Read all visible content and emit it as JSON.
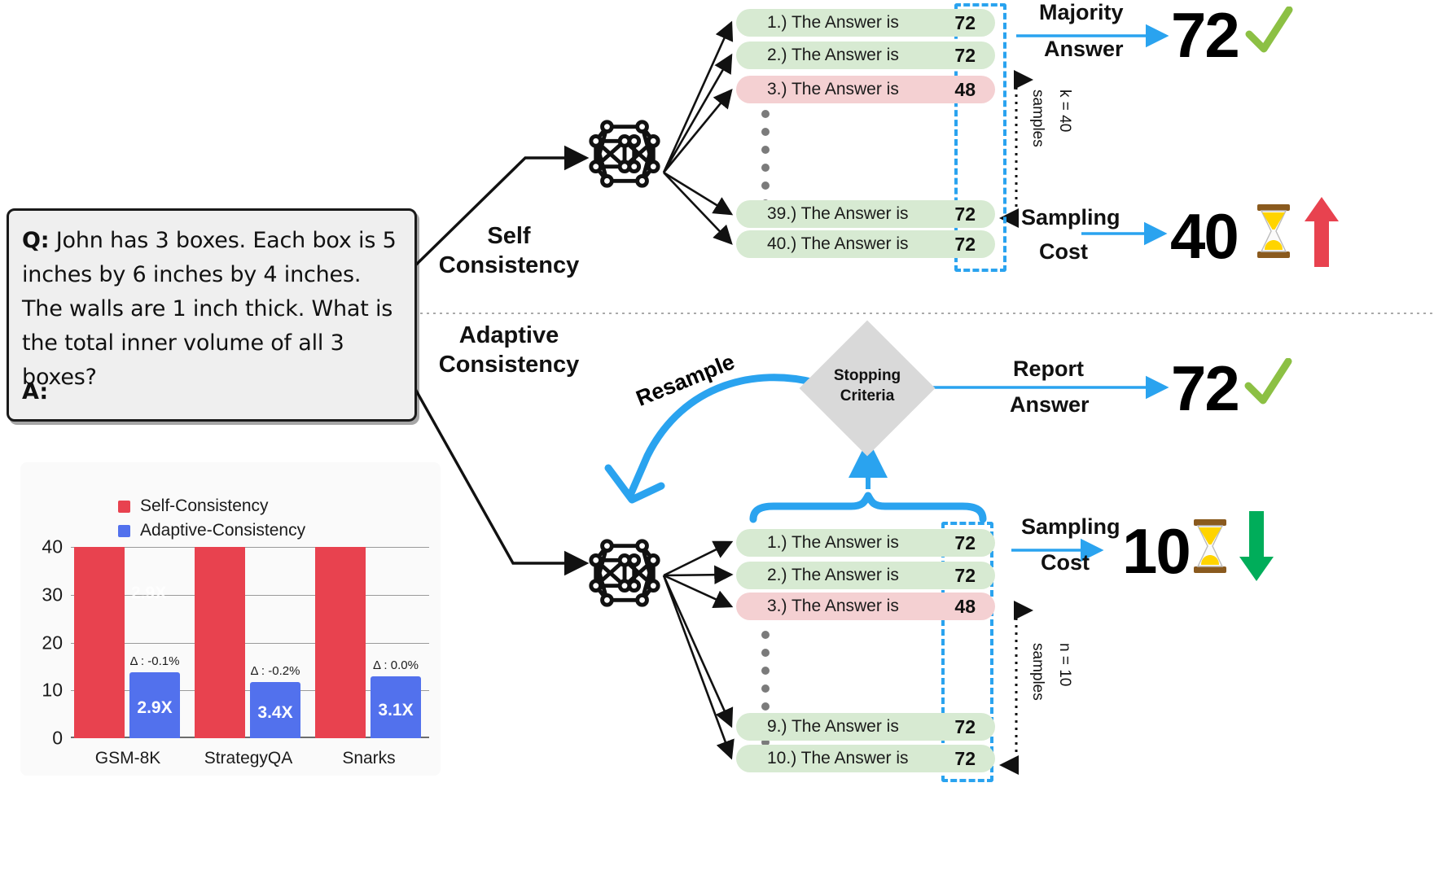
{
  "question_card": {
    "prompt_prefix": "Q:",
    "prompt_text": "John has 3 boxes.  Each box is 5 inches by 6 inches by 4 inches.  The walls are 1 inch thick. What is the total inner volume of all 3 boxes?",
    "answer_prefix": "A:"
  },
  "branch_labels": {
    "self_consistency": "Self\nConsistency",
    "self_consistency_line1": "Self",
    "self_consistency_line2": "Consistency",
    "adaptive_consistency_line1": "Adaptive",
    "adaptive_consistency_line2": "Consistency",
    "resample": "Resample"
  },
  "stopping_criteria": {
    "line1": "Stopping",
    "line2": "Criteria"
  },
  "self_consistency": {
    "rows": [
      {
        "label": "1.) The Answer is",
        "value": "72",
        "state": "green"
      },
      {
        "label": "2.) The Answer is",
        "value": "72",
        "state": "green"
      },
      {
        "label": "3.) The Answer is",
        "value": "48",
        "state": "red"
      },
      {
        "label": "39.) The Answer is",
        "value": "72",
        "state": "green"
      },
      {
        "label": "40.) The Answer is",
        "value": "72",
        "state": "green"
      }
    ],
    "samples_label_line1": "k = 40",
    "samples_label_line2": "samples",
    "majority_answer_line1": "Majority",
    "majority_answer_line2": "Answer",
    "majority_answer_value": "72",
    "sampling_cost_line1": "Sampling",
    "sampling_cost_line2": "Cost",
    "sampling_cost_value": "40",
    "cost_trend": "up"
  },
  "adaptive_consistency": {
    "rows": [
      {
        "label": "1.) The Answer is",
        "value": "72",
        "state": "green"
      },
      {
        "label": "2.) The Answer is",
        "value": "72",
        "state": "green"
      },
      {
        "label": "3.) The Answer is",
        "value": "48",
        "state": "red"
      },
      {
        "label": "9.) The Answer is",
        "value": "72",
        "state": "green"
      },
      {
        "label": "10.) The Answer is",
        "value": "72",
        "state": "green"
      }
    ],
    "samples_label_line1": "n = 10",
    "samples_label_line2": "samples",
    "report_answer_line1": "Report",
    "report_answer_line2": "Answer",
    "report_answer_value": "72",
    "sampling_cost_line1": "Sampling",
    "sampling_cost_line2": "Cost",
    "sampling_cost_value": "10",
    "cost_trend": "down"
  },
  "colors": {
    "self_consistency_bar": "#e8424f",
    "adaptive_consistency_bar": "#5271ed",
    "accent_blue": "#2aa3ef",
    "green_row": "#d7ead2",
    "red_row": "#f4d0d2",
    "check_green": "#8cc044",
    "arrow_up_red": "#e8424f",
    "arrow_down_green": "#00ad5a",
    "diamond_gray": "#d9d9d9"
  },
  "chart_data": {
    "type": "bar",
    "title": "",
    "xlabel": "",
    "ylabel": "",
    "ylim": [
      0,
      40
    ],
    "yticks": [
      0,
      10,
      20,
      30,
      40
    ],
    "grid": true,
    "legend_position": "top-center",
    "categories": [
      "GSM-8K",
      "StrategyQA",
      "Snarks"
    ],
    "series": [
      {
        "name": "Self-Consistency",
        "color": "#e8424f",
        "values": [
          40,
          40,
          40
        ]
      },
      {
        "name": "Adaptive-Consistency",
        "color": "#5271ed",
        "values": [
          13.8,
          11.8,
          12.9
        ]
      }
    ],
    "bar_labels": [
      "2.9X",
      "3.4X",
      "3.1X"
    ],
    "delta_labels": [
      "Δ : -0.1%",
      "Δ : -0.2%",
      "Δ : 0.0%"
    ],
    "ghost_label": "2.9X"
  }
}
